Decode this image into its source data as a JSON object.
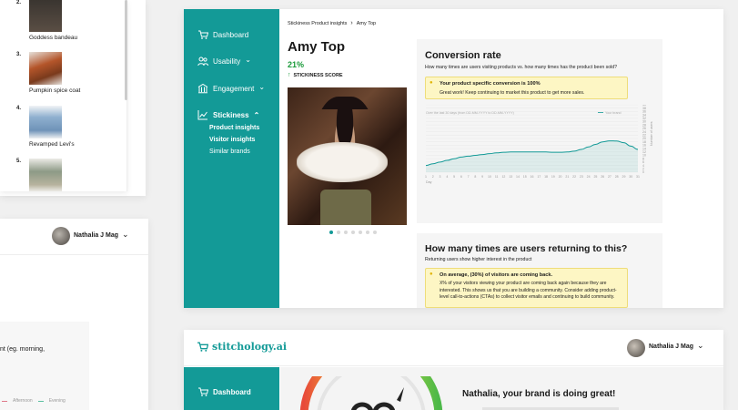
{
  "product_list": {
    "items": [
      {
        "rank": "2.",
        "name": "Goddess bandeau"
      },
      {
        "rank": "3.",
        "name": "Pumpkin spice coat"
      },
      {
        "rank": "4.",
        "name": "Revamped Levi's"
      },
      {
        "rank": "5.",
        "name": ""
      }
    ]
  },
  "left_card": {
    "user_name": "Nathalia J Mag",
    "fragment_text": "nt (eg. morning,",
    "legend": [
      "Afternoon",
      "Evening"
    ]
  },
  "sidebar": {
    "items": [
      {
        "label": "Dashboard",
        "icon": "cart-icon"
      },
      {
        "label": "Usability",
        "icon": "users-icon"
      },
      {
        "label": "Engagement",
        "icon": "building-icon"
      },
      {
        "label": "Stickiness",
        "icon": "chart-icon"
      }
    ],
    "sub_items": [
      "Product insights",
      "Visitor insights",
      "Similar brands"
    ]
  },
  "main": {
    "breadcrumb": [
      "Stickiness Product insights",
      "Amy Top"
    ],
    "product_title": "Amy Top",
    "stickiness_value": "21%",
    "stickiness_label": "STICKINESS SCORE",
    "carousel_dots": 7,
    "carousel_active": 0
  },
  "conversion": {
    "title": "Conversion rate",
    "subtitle": "How many times are users visiting products vs. how many times has the product been sold?",
    "note_title": "Your product specific conversion is 100%",
    "note_text": "Great work! Keep continuing to market this product to get more sales.",
    "chart_caption": "Over the last 30 days (from DD-MM-YYYY to DD-MM-YYYY)",
    "legend_label": "Your brand",
    "y_axis_label": "Number of users",
    "x_axis_label": "Day"
  },
  "returning": {
    "title": "How many times are users returning to this?",
    "subtitle": "Returning users show higher interest in the product",
    "note_title": "On average, (30%) of visitors are coming back.",
    "note_text": "X% of your visitors viewing your product are coming back again because they are interested. This shows us that you are building a community. Consider adding product-level call-to-actions (CTAs) to collect visitor emails and continuing to build community."
  },
  "bottom": {
    "brand_name": "stitchology.ai",
    "user_name": "Nathalia J Mag",
    "sidebar_label": "Dashboard",
    "greeting": "Nathalia, your brand is doing great!"
  },
  "chart_data": {
    "type": "area",
    "x": [
      1,
      2,
      3,
      4,
      5,
      6,
      7,
      8,
      9,
      10,
      11,
      12,
      13,
      14,
      15,
      16,
      17,
      18,
      19,
      20,
      21,
      22,
      23,
      24,
      25,
      26,
      27,
      28,
      29,
      30,
      31
    ],
    "series": [
      {
        "name": "Your brand",
        "values": [
          4,
          5,
          6,
          7,
          8,
          9,
          9.5,
          10,
          10.5,
          11,
          11.5,
          11.8,
          12,
          12,
          12,
          12,
          12,
          12,
          11.8,
          11.8,
          12,
          12.5,
          13.5,
          15,
          16.5,
          18,
          18.6,
          18.5,
          17.5,
          15.5,
          13.5
        ]
      }
    ],
    "ylim": [
      0,
      40
    ],
    "yticks": [
      0,
      2,
      4,
      6,
      8,
      10,
      12,
      14,
      16,
      18,
      20,
      22,
      24,
      26,
      28,
      30,
      32,
      34,
      36,
      38,
      40
    ],
    "accent": "#139a97"
  },
  "colors": {
    "brand": "#139a97",
    "positive": "#1a9a3a",
    "note_bg": "#fdf6c4"
  }
}
